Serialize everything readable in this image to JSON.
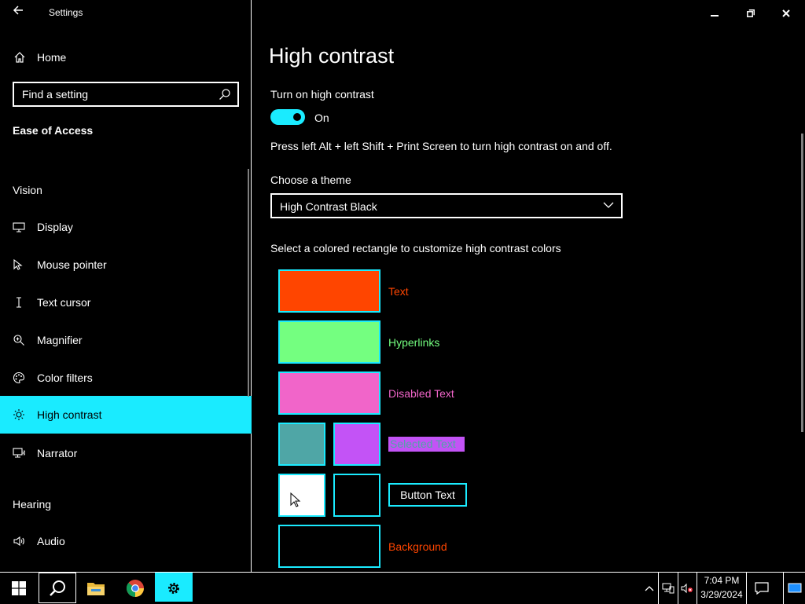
{
  "app": {
    "title": "Settings",
    "back_icon": "back-arrow-icon"
  },
  "sidebar": {
    "home_label": "Home",
    "search_placeholder": "Find a setting",
    "category": "Ease of Access",
    "sections": {
      "vision": "Vision",
      "hearing": "Hearing"
    },
    "items": [
      {
        "label": "Display",
        "icon": "monitor-icon"
      },
      {
        "label": "Mouse pointer",
        "icon": "mouse-pointer-icon"
      },
      {
        "label": "Text cursor",
        "icon": "text-cursor-icon"
      },
      {
        "label": "Magnifier",
        "icon": "magnifier-icon"
      },
      {
        "label": "Color filters",
        "icon": "palette-icon"
      },
      {
        "label": "High contrast",
        "icon": "sun-icon",
        "active": true
      },
      {
        "label": "Narrator",
        "icon": "narrator-icon"
      },
      {
        "label": "Audio",
        "icon": "speaker-icon"
      }
    ]
  },
  "window_controls": {
    "minimize": "minimize-icon",
    "restore": "restore-icon",
    "close": "close-icon"
  },
  "main": {
    "title": "High contrast",
    "toggle_label": "Turn on high contrast",
    "toggle_state": "On",
    "hint": "Press left Alt + left Shift + Print Screen to turn high contrast on and off.",
    "theme_label": "Choose a theme",
    "theme_value": "High Contrast Black",
    "colors_label": "Select a colored rectangle to customize high contrast colors",
    "colors": {
      "text": {
        "label": "Text",
        "color": "#ff4500"
      },
      "hyperlinks": {
        "label": "Hyperlinks",
        "color": "#74ff80"
      },
      "disabled": {
        "label": "Disabled Text",
        "color": "#f165c9"
      },
      "selected": {
        "label": "Selected Text",
        "bg": "#4fa6a6",
        "fg": "#c353f6"
      },
      "button": {
        "label": "Button Text",
        "bg": "#ffffff",
        "fg": "#000000"
      },
      "background": {
        "label": "Background",
        "color": "#000000"
      }
    }
  },
  "taskbar": {
    "time": "7:04 PM",
    "date": "3/29/2024",
    "accent": "#1aebff"
  }
}
